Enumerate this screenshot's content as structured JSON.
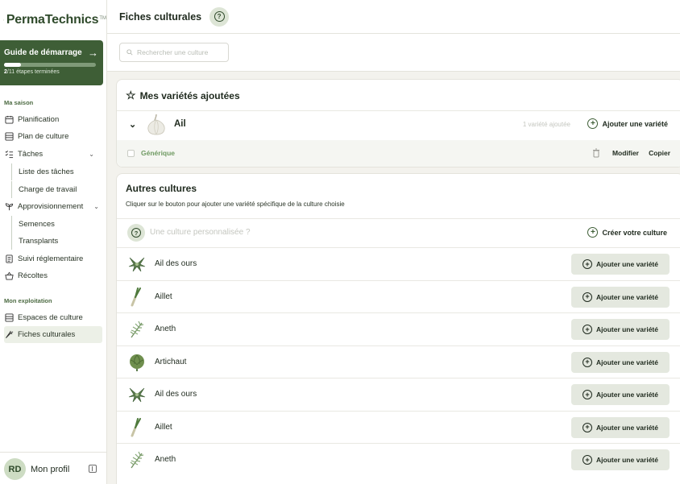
{
  "brand": {
    "name": "PermaTechnics",
    "tm": "TM"
  },
  "guide": {
    "title": "Guide de démarrage",
    "steps_done": "2",
    "steps_rest": "/11 étapes terminées",
    "progress": 0.18
  },
  "sidebar": {
    "section_season": "Ma saison",
    "items_season": [
      {
        "label": "Planification",
        "icon": "calendar-icon"
      },
      {
        "label": "Plan de culture",
        "icon": "list-icon"
      },
      {
        "label": "Tâches",
        "icon": "tasks-icon"
      },
      {
        "label": "Liste des tâches"
      },
      {
        "label": "Charge de travail"
      },
      {
        "label": "Approvisionnement",
        "icon": "sprout-icon"
      },
      {
        "label": "Semences"
      },
      {
        "label": "Transplants"
      },
      {
        "label": "Suivi réglementaire",
        "icon": "document-icon"
      },
      {
        "label": "Récoltes",
        "icon": "basket-icon"
      }
    ],
    "section_farm": "Mon exploitation",
    "items_farm": [
      {
        "label": "Espaces de culture",
        "icon": "grid-icon"
      },
      {
        "label": "Fiches culturales",
        "icon": "carrot-icon"
      }
    ]
  },
  "profile": {
    "initials": "RD",
    "name": "Mon profil"
  },
  "header": {
    "title": "Fiches culturales",
    "help": "?"
  },
  "search": {
    "placeholder": "Rechercher une culture"
  },
  "my_varieties": {
    "title": "Mes variétés ajoutées",
    "crop": {
      "name": "Ail",
      "count": "1 variété ajoutée",
      "add_label": "Ajouter une variété"
    },
    "variety": {
      "name": "Générique",
      "edit": "Modifier",
      "copy": "Copier"
    }
  },
  "other_crops": {
    "title": "Autres cultures",
    "subtitle": "Cliquer sur le bouton pour ajouter une variété spécifique de la culture choisie",
    "custom_placeholder": "Une culture personnalisée ?",
    "create_label": "Créer votre culture",
    "add_label": "Ajouter une variété",
    "crops": [
      {
        "name": "Ail des ours",
        "icon": "wild-garlic-icon"
      },
      {
        "name": "Aillet",
        "icon": "leek-icon"
      },
      {
        "name": "Aneth",
        "icon": "dill-icon"
      },
      {
        "name": "Artichaut",
        "icon": "artichoke-icon"
      },
      {
        "name": "Ail des ours",
        "icon": "wild-garlic-icon"
      },
      {
        "name": "Aillet",
        "icon": "leek-icon"
      },
      {
        "name": "Aneth",
        "icon": "dill-icon"
      }
    ]
  },
  "colors": {
    "brand_green": "#3e5e36",
    "accent_light": "#dde5d6",
    "button_bg": "#e4e8df"
  }
}
